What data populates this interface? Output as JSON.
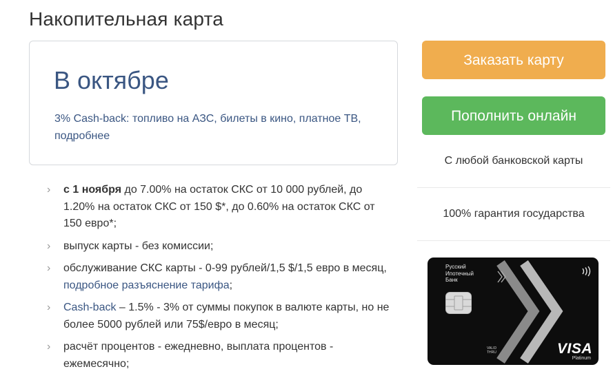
{
  "page": {
    "title": "Накопительная карта"
  },
  "promo": {
    "heading": "В октябре",
    "text": "3% Cash-back: топливо на АЗС, билеты в кино, платное ТВ,",
    "link": "подробнее"
  },
  "features": [
    {
      "bold": "с 1 ноября",
      "text": " до 7.00% на остаток СКС от 10 000 рублей, до 1.20% на остаток СКС от 150 $*, до 0.60% на остаток СКС от 150 евро*;"
    },
    {
      "text": "выпуск карты - без комиссии;"
    },
    {
      "text": "обслуживание СКС карты - 0-99 рублей/1,5 $/1,5 евро в месяц,",
      "link": "подробное разъяснение тарифа",
      "suffix": ";"
    },
    {
      "link": "Cash-back",
      "text": " – 1.5% - 3% от суммы покупок в валюте карты, но не более 5000 рублей или 75$/евро в месяц;"
    },
    {
      "text": "расчёт процентов - ежедневно, выплата процентов - ежемесячно;"
    }
  ],
  "actions": {
    "order_label": "Заказать карту",
    "topup_label": "Пополнить онлайн"
  },
  "side_notes": {
    "any_card": "С любой банковской карты",
    "guarantee": "100% гарантия государства"
  },
  "card": {
    "bank_line1": "Русский",
    "bank_line2": "Ипотечный",
    "bank_line3": "Банк",
    "valid_line1": "VALID",
    "valid_line2": "THRU",
    "brand": "VISA",
    "tier": "Platinum"
  },
  "colors": {
    "order_button": "#f0ad4e",
    "topup_button": "#5cb85c",
    "link": "#3a5682",
    "card_background": "#0d0d0d"
  },
  "icons": {
    "list_bullet": "chevron-right-icon",
    "card_contactless": "contactless-icon",
    "card_chip": "chip-icon"
  }
}
